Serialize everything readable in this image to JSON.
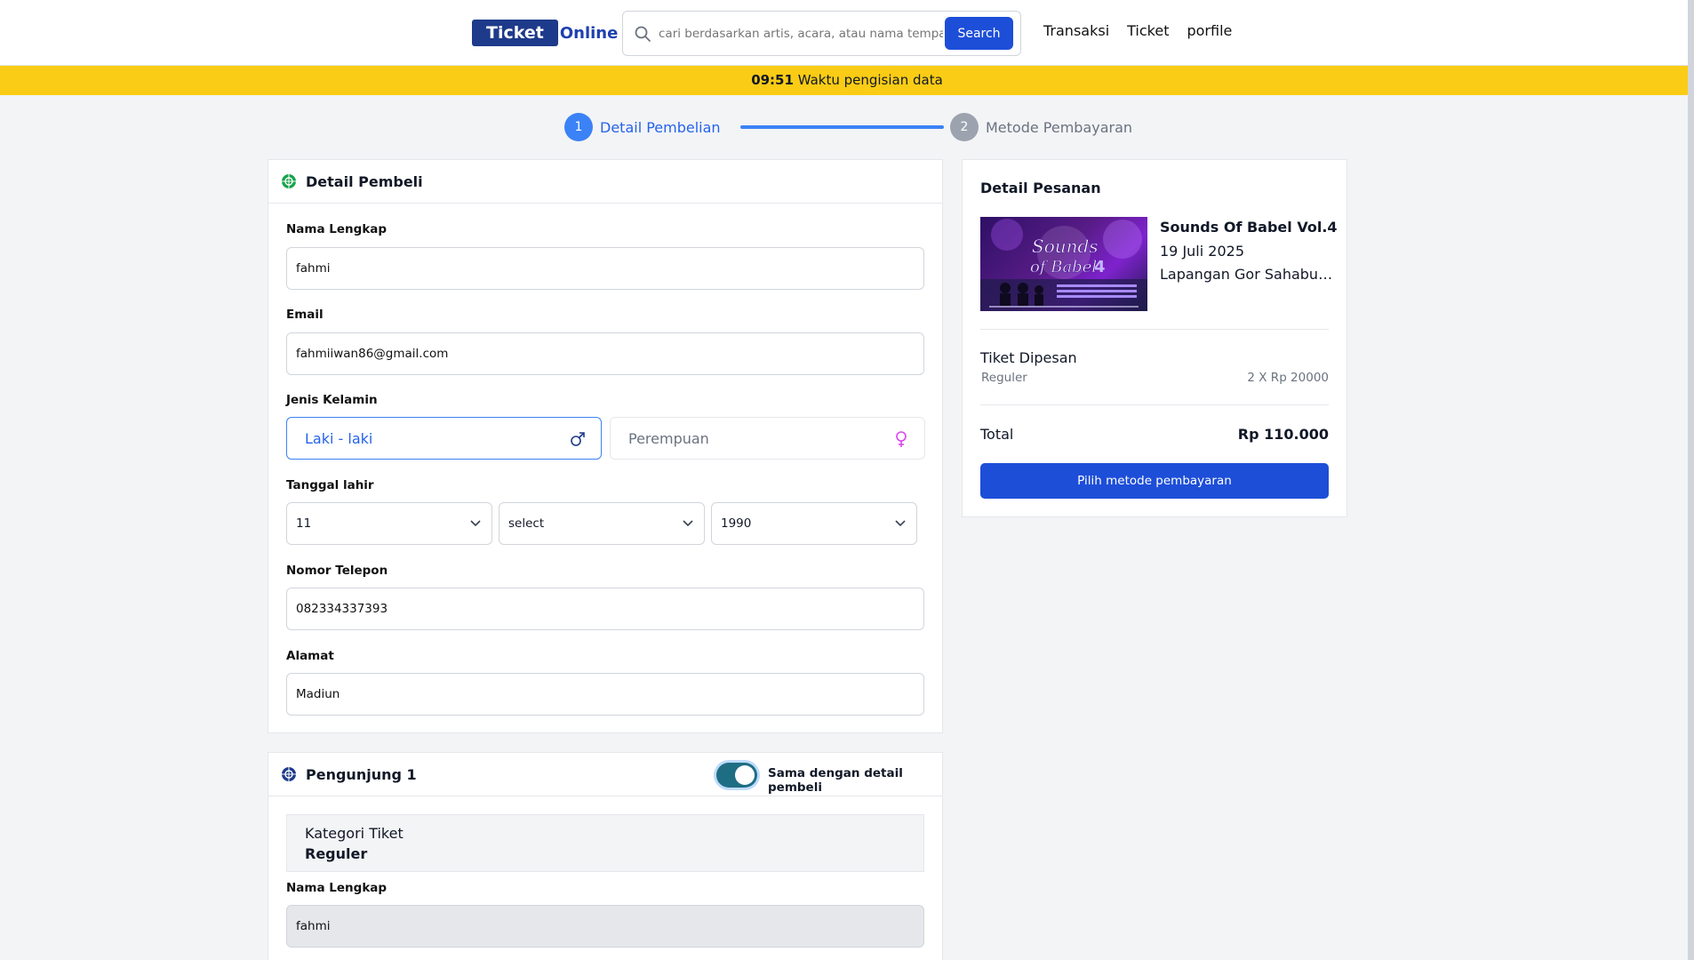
{
  "header": {
    "logo_part1": "Ticket",
    "logo_part2": "Online",
    "search_placeholder": "cari berdasarkan artis, acara, atau nama tempat",
    "search_button": "Search",
    "nav": [
      "Transaksi",
      "Ticket",
      "porfile"
    ]
  },
  "timer": {
    "time": "09:51",
    "text": " Waktu pengisian data"
  },
  "steps": [
    {
      "num": "1",
      "label": "Detail Pembelian"
    },
    {
      "num": "2",
      "label": "Metode Pembayaran"
    }
  ],
  "buyer": {
    "title": "Detail Pembeli",
    "name_label": "Nama Lengkap",
    "name_value": "fahmi",
    "email_label": "Email",
    "email_value": "fahmiiwan86@gmail.com",
    "gender_label": "Jenis Kelamin",
    "gender_male": "Laki - laki",
    "gender_female": "Perempuan",
    "dob_label": "Tanggal lahir",
    "dob_day": "11",
    "dob_month": "select",
    "dob_year": "1990",
    "phone_label": "Nomor Telepon",
    "phone_value": "082334337393",
    "address_label": "Alamat",
    "address_value": "Madiun"
  },
  "visitor": {
    "title": "Pengunjung 1",
    "toggle_label": "Sama dengan detail pembeli",
    "category_label": "Kategori Tiket",
    "category_value": "Reguler",
    "name_label": "Nama Lengkap",
    "name_value": "fahmi"
  },
  "order": {
    "title": "Detail Pesanan",
    "poster_text": "Sounds of Babel 4",
    "event_name": "Sounds Of Babel Vol.4",
    "event_date": "19 Juli 2025",
    "event_place": "Lapangan Gor Sahabudin Madiun",
    "ticket_label": "Tiket Dipesan",
    "ticket_type": "Reguler",
    "ticket_qty": "2 X Rp 20000",
    "total_label": "Total",
    "total_value": "Rp 110.000",
    "pay_button": "Pilih metode pembayaran"
  },
  "colors": {
    "primary": "#1d4ed8",
    "timer_bg": "#facc15",
    "step_active": "#3b82f6"
  }
}
